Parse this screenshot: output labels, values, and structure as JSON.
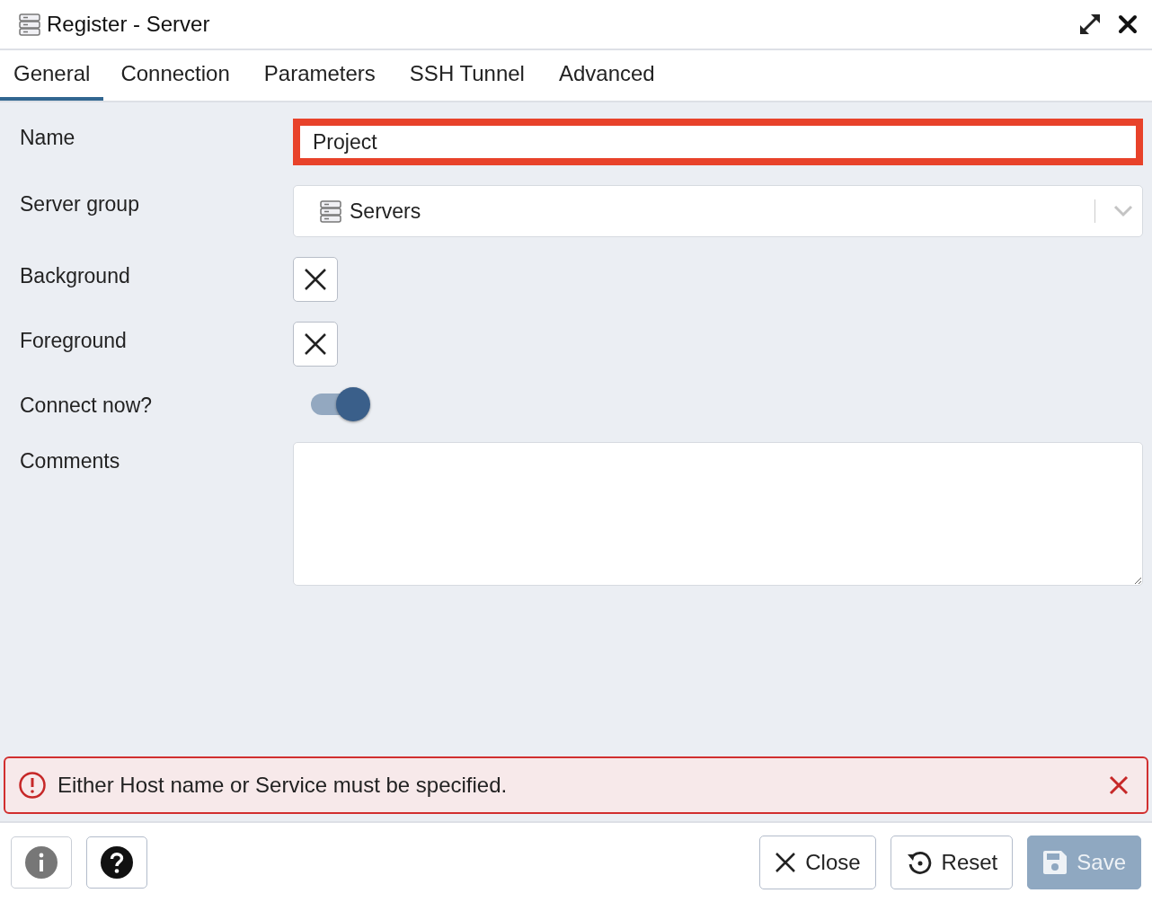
{
  "window": {
    "title": "Register - Server"
  },
  "tabs": [
    {
      "label": "General",
      "selected": true
    },
    {
      "label": "Connection",
      "selected": false
    },
    {
      "label": "Parameters",
      "selected": false
    },
    {
      "label": "SSH Tunnel",
      "selected": false
    },
    {
      "label": "Advanced",
      "selected": false
    }
  ],
  "fields": [
    {
      "kind": "text",
      "label": "Name",
      "value": "Project",
      "error": true
    },
    {
      "kind": "select",
      "label": "Server group",
      "value": "Servers"
    },
    {
      "kind": "color",
      "label": "Background"
    },
    {
      "kind": "color",
      "label": "Foreground"
    },
    {
      "kind": "switch",
      "label": "Connect now?",
      "on": true
    },
    {
      "kind": "textarea",
      "label": "Comments"
    }
  ],
  "error_banner": {
    "message": "Either Host name or Service must be specified."
  },
  "footer": {
    "left_buttons": [
      {
        "kind": "info"
      },
      {
        "kind": "help"
      }
    ],
    "right_buttons": [
      {
        "kind": "close",
        "label": "Close",
        "disabled": false
      },
      {
        "kind": "reset",
        "label": "Reset",
        "disabled": false
      },
      {
        "kind": "save",
        "label": "Save",
        "disabled": true
      }
    ]
  }
}
